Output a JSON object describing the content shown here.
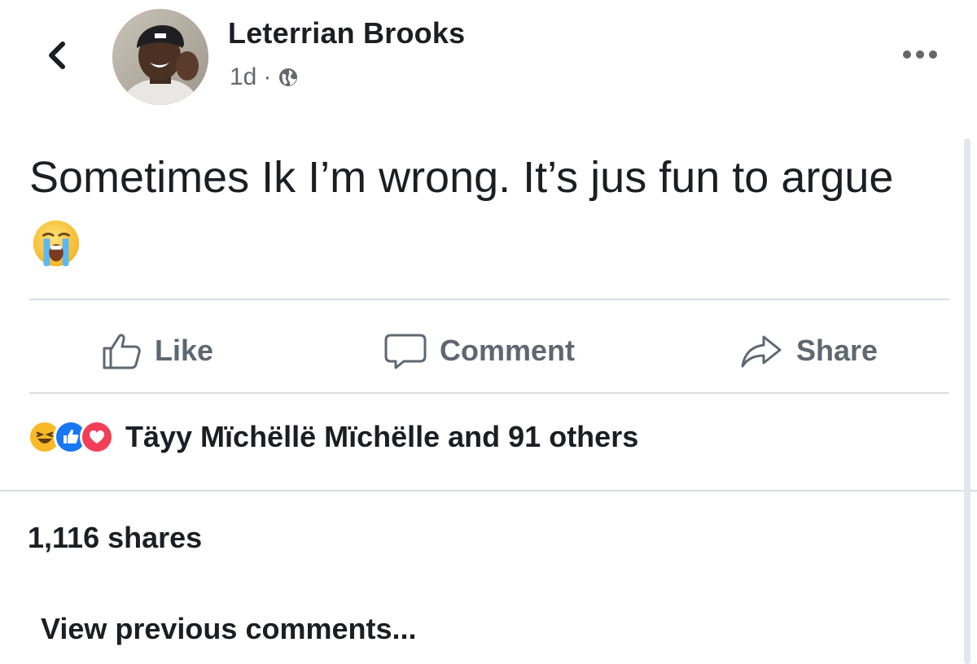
{
  "post": {
    "author_name": "Leterrian Brooks",
    "timestamp": "1d",
    "separator": "·",
    "privacy_icon": "globe-icon",
    "text_main": "Sometimes Ik I’m wrong. It’s jus fun to argue",
    "emoji": "crying-face-emoji"
  },
  "header": {
    "back_icon": "chevron-left-icon",
    "more_icon": "more-dots-icon"
  },
  "actions": {
    "like_label": "Like",
    "comment_label": "Comment",
    "share_label": "Share"
  },
  "reactions": {
    "icons": [
      "haha-icon",
      "like-icon",
      "love-icon"
    ],
    "summary": "Täyy Mïchëllë Mïchëlle and 91 others"
  },
  "shares": {
    "label": "1,116 shares"
  },
  "comments": {
    "view_previous": "View previous comments..."
  },
  "colors": {
    "text": "#1c1e21",
    "secondary": "#65676b",
    "like_blue": "#1877f2",
    "love_red": "#f33e58",
    "haha_yellow": "#f7b928"
  }
}
